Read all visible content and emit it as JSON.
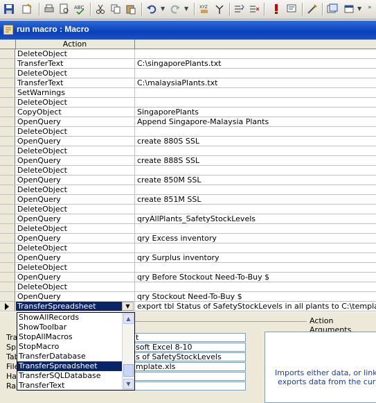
{
  "window": {
    "title": "run macro : Macro"
  },
  "grid": {
    "column_header": "Action",
    "rows": [
      {
        "action": "DeleteObject",
        "args": ""
      },
      {
        "action": "TransferText",
        "args": "C:\\singaporePlants.txt"
      },
      {
        "action": "DeleteObject",
        "args": ""
      },
      {
        "action": "TransferText",
        "args": "C:\\malaysiaPlants.txt"
      },
      {
        "action": "SetWarnings",
        "args": ""
      },
      {
        "action": "DeleteObject",
        "args": ""
      },
      {
        "action": "CopyObject",
        "args": "SingaporePlants"
      },
      {
        "action": "OpenQuery",
        "args": "Append Singapore-Malaysia Plants"
      },
      {
        "action": "DeleteObject",
        "args": ""
      },
      {
        "action": "OpenQuery",
        "args": "create 880S SSL"
      },
      {
        "action": "DeleteObject",
        "args": ""
      },
      {
        "action": "OpenQuery",
        "args": "create 888S SSL"
      },
      {
        "action": "DeleteObject",
        "args": ""
      },
      {
        "action": "OpenQuery",
        "args": "create 850M SSL"
      },
      {
        "action": "DeleteObject",
        "args": ""
      },
      {
        "action": "OpenQuery",
        "args": "create 851M SSL"
      },
      {
        "action": "DeleteObject",
        "args": ""
      },
      {
        "action": "OpenQuery",
        "args": "qryAllPlants_SafetyStockLevels"
      },
      {
        "action": "DeleteObject",
        "args": ""
      },
      {
        "action": "OpenQuery",
        "args": "qry Excess inventory"
      },
      {
        "action": "DeleteObject",
        "args": ""
      },
      {
        "action": "OpenQuery",
        "args": "qry Surplus inventory"
      },
      {
        "action": "DeleteObject",
        "args": ""
      },
      {
        "action": "OpenQuery",
        "args": "qry Before Stockout Need-To-Buy $"
      },
      {
        "action": "DeleteObject",
        "args": ""
      },
      {
        "action": "OpenQuery",
        "args": "qry Stockout Need-To-Buy $"
      },
      {
        "action": "TransferSpreadsheet",
        "args": "export tbl Status of SafetyStockLevels in all plants to C:\\template.xls"
      }
    ]
  },
  "action_list": {
    "items": [
      "ShowAllRecords",
      "ShowToolbar",
      "StopAllMacros",
      "StopMacro",
      "TransferDatabase",
      "TransferSpreadsheet",
      "TransferSQLDatabase",
      "TransferText"
    ],
    "selected_index": 5
  },
  "action_arguments": {
    "title": "Action Arguments",
    "labels": [
      "Tra",
      "Spr",
      "Tab",
      "File",
      "Has",
      "Ran"
    ],
    "values": [
      "t",
      "soft Excel 8-10",
      "s of SafetyStockLevels",
      "mplate.xls",
      "",
      ""
    ],
    "help_line1": "Imports either data, or links to",
    "help_line2": "exports data from the current"
  },
  "colors": {
    "titlebar": "#0a3fb8",
    "selection": "#0a246a",
    "help_text": "#1b3aa8"
  }
}
